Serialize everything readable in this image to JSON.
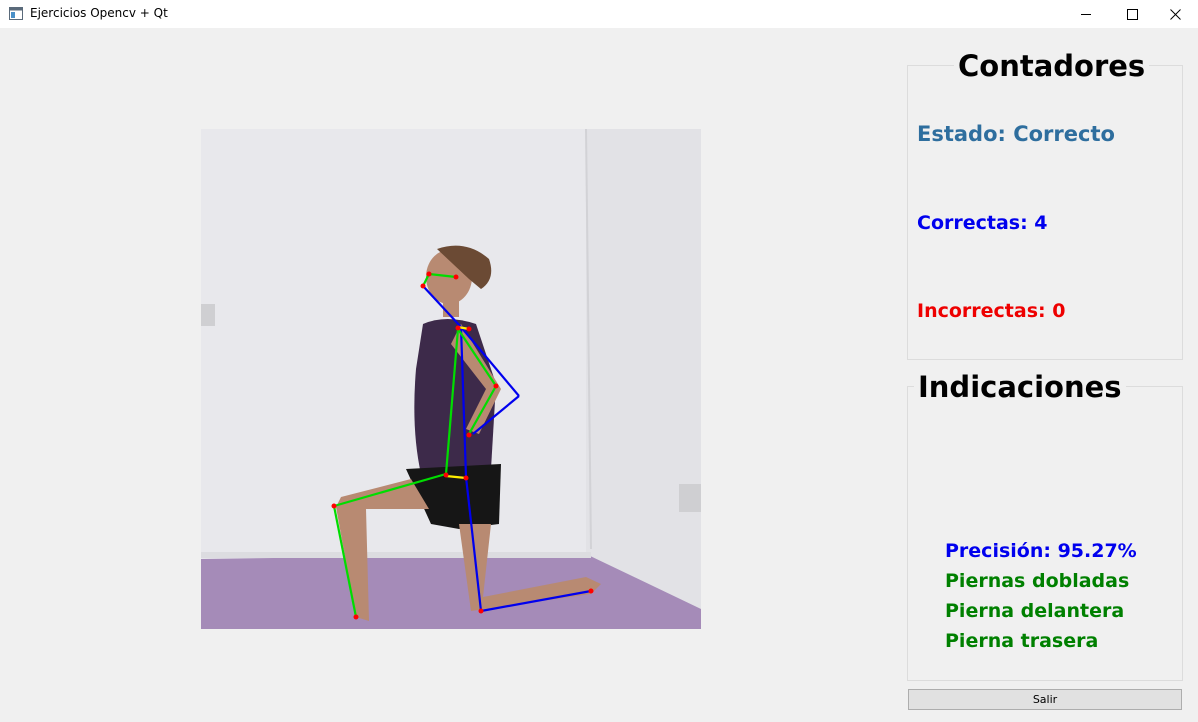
{
  "window": {
    "title": "Ejercicios Opencv + Qt",
    "icon": "app-window-icon",
    "controls": [
      "minimize-icon",
      "maximize-icon",
      "close-icon"
    ]
  },
  "video": {
    "description_icon": "pose-skeleton-overlay",
    "colors": {
      "left_limbs": "#00dd00",
      "right_limbs": "#0000ee",
      "joints": "#ff0000",
      "torso": "#ffff00"
    }
  },
  "counters": {
    "title": "Contadores",
    "estado": "Estado: Correcto",
    "correctas": "Correctas: 4",
    "incorrectas": "Incorrectas: 0",
    "colors": {
      "estado": "#2e6e9e",
      "correctas": "#0000ee",
      "incorrectas": "#ee0000"
    }
  },
  "indications": {
    "title": "Indicaciones",
    "precision": "Precisión: 95.27%",
    "items": [
      "Piernas dobladas",
      "Pierna delantera",
      "Pierna trasera"
    ],
    "colors": {
      "precision": "#0000ee",
      "items": "#008000"
    }
  },
  "exit_button": {
    "label": "Salir"
  }
}
